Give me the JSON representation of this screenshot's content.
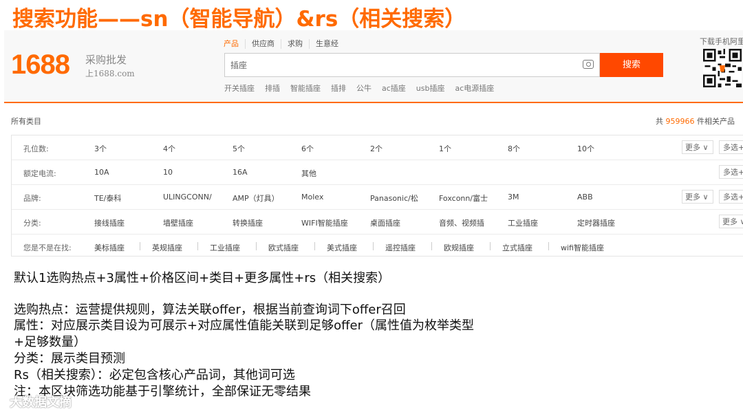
{
  "slide": {
    "title": "搜索功能——sn（智能导航）&rs（相关搜索）"
  },
  "header": {
    "logo_number": "1688",
    "logo_slogan": "采购批发",
    "logo_domain": "上1688.com",
    "search_tabs": [
      "产品",
      "供应商",
      "求购",
      "生意经"
    ],
    "search_query": "插座",
    "search_button": "搜索",
    "hot_words": [
      "开关插座",
      "排插",
      "智能插座",
      "插排",
      "公牛",
      "ac插座",
      "usb插座",
      "ac电源插座"
    ],
    "download_label": "下载手机阿里"
  },
  "summary": {
    "breadcrumb": "所有类目",
    "total_prefix": "共 ",
    "total_count": "959966",
    "total_suffix": " 件相关产品"
  },
  "filters": [
    {
      "label": "孔位数:",
      "options": [
        "3个",
        "4个",
        "5个",
        "6个",
        "2个",
        "1个",
        "8个",
        "10个"
      ],
      "more": "更多",
      "multi": "多选+"
    },
    {
      "label": "额定电流:",
      "options": [
        "10A",
        "10",
        "16A",
        "其他"
      ],
      "multi": "多选+"
    },
    {
      "label": "品牌:",
      "options": [
        "TE/泰科",
        "ULINGCONN/",
        "AMP（灯具）",
        "Molex",
        "Panasonic/松",
        "Foxconn/富士",
        "3M",
        "ABB"
      ],
      "more": "更多",
      "multi": "多选+"
    },
    {
      "label": "分类:",
      "options": [
        "接线插座",
        "墙壁插座",
        "转换插座",
        "WIFI智能插座",
        "桌面插座",
        "音频、视频插",
        "工业插座",
        "定时器插座"
      ],
      "more": "更多"
    }
  ],
  "related_search": {
    "label": "您是不是在找:",
    "options": [
      "美标插座",
      "英规插座",
      "工业插座",
      "欧式插座",
      "美式插座",
      "遥控插座",
      "欧规插座",
      "立式插座",
      "wifi智能插座"
    ]
  },
  "notes": [
    "默认1选购热点+3属性+价格区间+类目+更多属性+rs（相关搜索）",
    "选购热点：运营提供规则，算法关联offer，根据当前查询词下offer召回",
    "属性：对应展示类目设为可展示+对应属性值能关联到足够offer（属性值为枚举类型",
    "+足够数量）",
    "分类：展示类目预测",
    "Rs（相关搜索）：必定包含核心产品词，其他词可选",
    "注：本区块筛选功能基于引擎统计，全部保证无零结果"
  ],
  "watermark": "大数据文摘",
  "colors": {
    "accent": "#ff6a00",
    "search_button": "#ff4800"
  },
  "icons": {
    "camera": "camera-icon",
    "chevron": "chevron-down-icon",
    "qr": "qr-code"
  }
}
